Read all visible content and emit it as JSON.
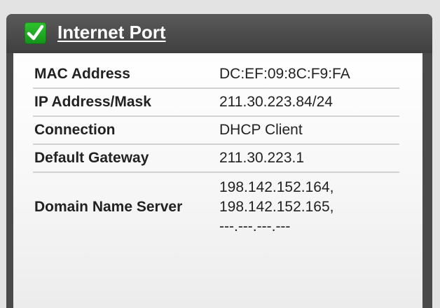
{
  "header": {
    "title": "Internet Port",
    "status_icon": "check-icon",
    "status_color": "#1faa22"
  },
  "rows": [
    {
      "label": "MAC Address",
      "value": "DC:EF:09:8C:F9:FA"
    },
    {
      "label": "IP Address/Mask",
      "value": "211.30.223.84/24"
    },
    {
      "label": "Connection",
      "value": "DHCP Client"
    },
    {
      "label": "Default Gateway",
      "value": "211.30.223.1"
    }
  ],
  "dns": {
    "label": "Domain Name Server",
    "servers": [
      "198.142.152.164,",
      "198.142.152.165,",
      "---.---.---.---"
    ]
  }
}
